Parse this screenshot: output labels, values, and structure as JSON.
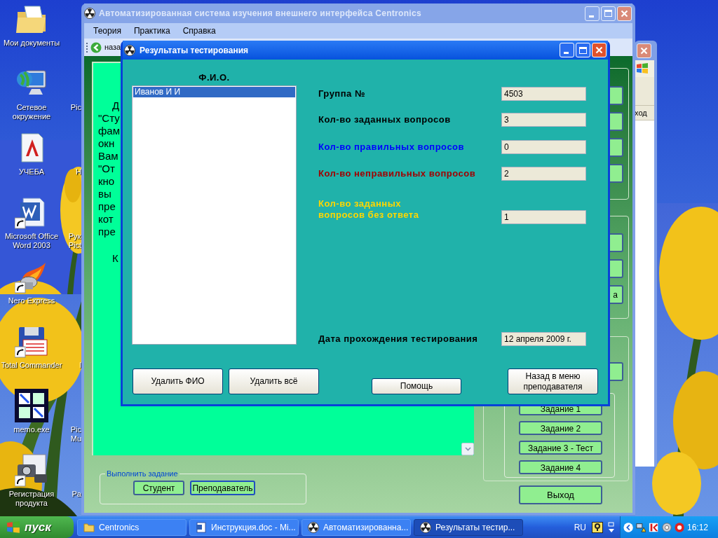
{
  "desktop": {
    "icons": [
      {
        "label": "Мои документы",
        "kind": "folder",
        "shortcut": false
      },
      {
        "label": "Сетевое окружение",
        "kind": "network",
        "shortcut": false,
        "neighbor": "Pic"
      },
      {
        "label": "УЧЕБА",
        "kind": "letter",
        "shortcut": false,
        "neighbor": "Н"
      },
      {
        "label": "Microsoft Office Word 2003",
        "kind": "word",
        "shortcut": true,
        "neighbor": "Рук\nPict"
      },
      {
        "label": "Nero Express",
        "kind": "flame",
        "shortcut": true
      },
      {
        "label": "Total Commander",
        "kind": "floppy",
        "shortcut": true,
        "neighbor": "I"
      },
      {
        "label": "memo.exe",
        "kind": "cubes",
        "shortcut": false,
        "neighbor": "Pic\nMu"
      },
      {
        "label": "Регистрация продукта",
        "kind": "camera",
        "shortcut": true,
        "neighbor": "Pa"
      }
    ]
  },
  "back_window": {
    "text": "ход"
  },
  "main_window": {
    "title": "Автоматизированная система изучения внешнего интерфейса Centronics",
    "active": false,
    "menu": [
      "Теория",
      "Практика",
      "Справка"
    ],
    "toolbar": {
      "back": "наза"
    },
    "text_paragraphs": [
      {
        "lines": [
          "Д",
          "\"Сту",
          "фам",
          "окн",
          "Вам",
          "\"От",
          "кно",
          "вы",
          "пре",
          "кот",
          "пре"
        ]
      },
      {
        "lines": [
          "К"
        ]
      }
    ],
    "task_group": {
      "title": "Выполнить задание",
      "buttons": [
        {
          "label": "Студент",
          "focused": false
        },
        {
          "label": "Преподаватель",
          "focused": true
        }
      ]
    },
    "side_groups": [
      {
        "buttons": [
          {
            "kind": "button"
          },
          {
            "kind": "button"
          },
          {
            "kind": "button"
          },
          {
            "kind": "button"
          }
        ]
      },
      {
        "buttons": [
          {
            "kind": "button"
          },
          {
            "kind": "button"
          },
          {
            "kind": "button",
            "label": "а"
          }
        ]
      },
      {
        "buttons": [
          {
            "kind": "button"
          }
        ],
        "tasks": [
          "Задание 1",
          "Задание 2",
          "Задание 3 - Тест",
          "Задание 4"
        ]
      }
    ],
    "exit": "Выход"
  },
  "dialog": {
    "title": "Результаты тестирования",
    "active": true,
    "list_title": "Ф.И.О.",
    "names": [
      {
        "text": "Иванов И И",
        "selected": true
      }
    ],
    "fields": [
      {
        "label": "Группа №",
        "value": "4503",
        "color": "#000000",
        "kind": "single"
      },
      {
        "label": "Кол-во заданных вопросов",
        "value": "3",
        "color": "#000000",
        "kind": "single"
      },
      {
        "label": "Кол-во правильных вопросов",
        "value": "0",
        "color": "#0000ff",
        "kind": "single"
      },
      {
        "label": "Кол-во неправильных вопросов",
        "value": "2",
        "color": "#a00000",
        "kind": "single"
      },
      {
        "label": "Кол-во заданных\nвопросов без ответа",
        "value": "1",
        "color": "#ffd700",
        "kind": "wrapped"
      },
      {
        "label": "Дата прохождения тестирования",
        "value": "12 апреля 2009 г.",
        "color": "#000000",
        "kind": "single"
      }
    ],
    "buttons": [
      "Удалить ФИО",
      "Удалить всё",
      "Помощь",
      "Назад в меню преподавателя"
    ]
  },
  "taskbar": {
    "start": "пуск",
    "items": [
      {
        "label": "Centronics",
        "kind": "folder",
        "selected": false
      },
      {
        "label": "Инструкция.doc - Mi...",
        "kind": "doc",
        "selected": false
      },
      {
        "label": "Автоматизированна...",
        "kind": "app",
        "selected": false
      },
      {
        "label": "Результаты тестир...",
        "kind": "app",
        "selected": true
      }
    ],
    "language": "RU",
    "clock": "16:12"
  }
}
